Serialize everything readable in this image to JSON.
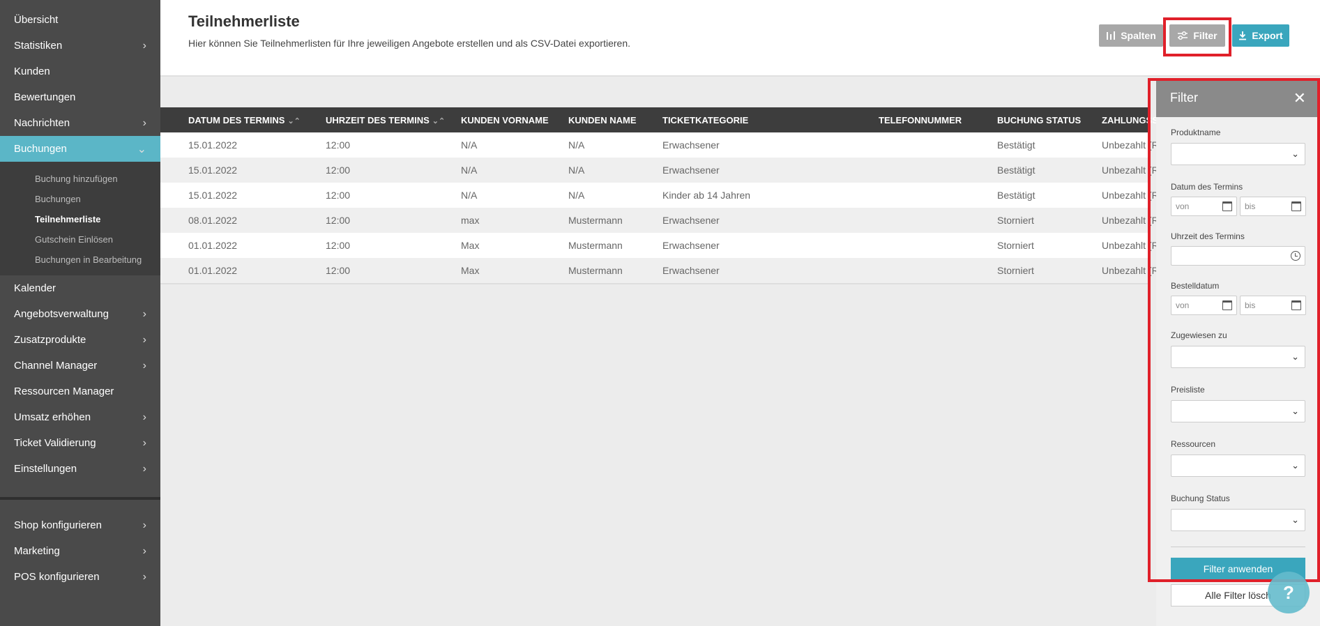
{
  "sidebar": {
    "items": [
      {
        "label": "Übersicht",
        "chevron": ""
      },
      {
        "label": "Statistiken",
        "chevron": "›"
      },
      {
        "label": "Kunden",
        "chevron": ""
      },
      {
        "label": "Bewertungen",
        "chevron": ""
      },
      {
        "label": "Nachrichten",
        "chevron": "›"
      },
      {
        "label": "Buchungen",
        "chevron": "⌄"
      }
    ],
    "subitems": [
      {
        "label": "Buchung hinzufügen"
      },
      {
        "label": "Buchungen"
      },
      {
        "label": "Teilnehmerliste"
      },
      {
        "label": "Gutschein Einlösen"
      },
      {
        "label": "Buchungen in Bearbeitung"
      }
    ],
    "items2": [
      {
        "label": "Kalender",
        "chevron": ""
      },
      {
        "label": "Angebotsverwaltung",
        "chevron": "›"
      },
      {
        "label": "Zusatzprodukte",
        "chevron": "›"
      },
      {
        "label": "Channel Manager",
        "chevron": "›"
      },
      {
        "label": "Ressourcen Manager",
        "chevron": ""
      },
      {
        "label": "Umsatz erhöhen",
        "chevron": "›"
      },
      {
        "label": "Ticket Validierung",
        "chevron": "›"
      },
      {
        "label": "Einstellungen",
        "chevron": "›"
      }
    ],
    "items3": [
      {
        "label": "Shop konfigurieren",
        "chevron": "›"
      },
      {
        "label": "Marketing",
        "chevron": "›"
      },
      {
        "label": "POS konfigurieren",
        "chevron": "›"
      }
    ]
  },
  "header": {
    "title": "Teilnehmerliste",
    "description": "Hier können Sie Teilnehmerlisten für Ihre jeweiligen Angebote erstellen und als CSV-Datei exportieren.",
    "spalten_label": "Spalten",
    "filter_label": "Filter",
    "export_label": "Export"
  },
  "table": {
    "columns": [
      "DATUM DES TERMINS",
      "UHRZEIT DES TERMINS",
      "KUNDEN VORNAME",
      "KUNDEN NAME",
      "TICKETKATEGORIE",
      "TELEFONNUMMER",
      "BUCHUNG STATUS",
      "ZAHLUNGSSTATUS"
    ],
    "sort_glyph": "⌄⌃",
    "rows": [
      [
        "15.01.2022",
        "12:00",
        "N/A",
        "N/A",
        "Erwachsener",
        "",
        "Bestätigt",
        "Unbezahlt (Registrierkasse)"
      ],
      [
        "15.01.2022",
        "12:00",
        "N/A",
        "N/A",
        "Erwachsener",
        "",
        "Bestätigt",
        "Unbezahlt (Registrierkasse)"
      ],
      [
        "15.01.2022",
        "12:00",
        "N/A",
        "N/A",
        "Kinder ab 14 Jahren",
        "",
        "Bestätigt",
        "Unbezahlt (Registrierkasse)"
      ],
      [
        "08.01.2022",
        "12:00",
        "max",
        "Mustermann",
        "Erwachsener",
        "",
        "Storniert",
        "Unbezahlt (Rechnung)"
      ],
      [
        "01.01.2022",
        "12:00",
        "Max",
        "Mustermann",
        "Erwachsener",
        "",
        "Storniert",
        "Unbezahlt (Rechnung)"
      ],
      [
        "01.01.2022",
        "12:00",
        "Max",
        "Mustermann",
        "Erwachsener",
        "",
        "Storniert",
        "Unbezahlt (Rechnung)"
      ]
    ]
  },
  "filter": {
    "title": "Filter",
    "close_glyph": "✕",
    "produktname_label": "Produktname",
    "datum_label": "Datum des Termins",
    "uhrzeit_label": "Uhrzeit des Termins",
    "bestelldatum_label": "Bestelldatum",
    "zugewiesen_label": "Zugewiesen zu",
    "preisliste_label": "Preisliste",
    "ressourcen_label": "Ressourcen",
    "buchungstatus_label": "Buchung Status",
    "von_placeholder": "von",
    "bis_placeholder": "bis",
    "apply_label": "Filter anwenden",
    "clear_label": "Alle Filter lösch",
    "select_arrow": "⌄"
  },
  "help": {
    "label": "?"
  },
  "colors": {
    "accent": "#3aa6bd",
    "active_nav": "#5bb6c7",
    "highlight": "#e0202a"
  }
}
